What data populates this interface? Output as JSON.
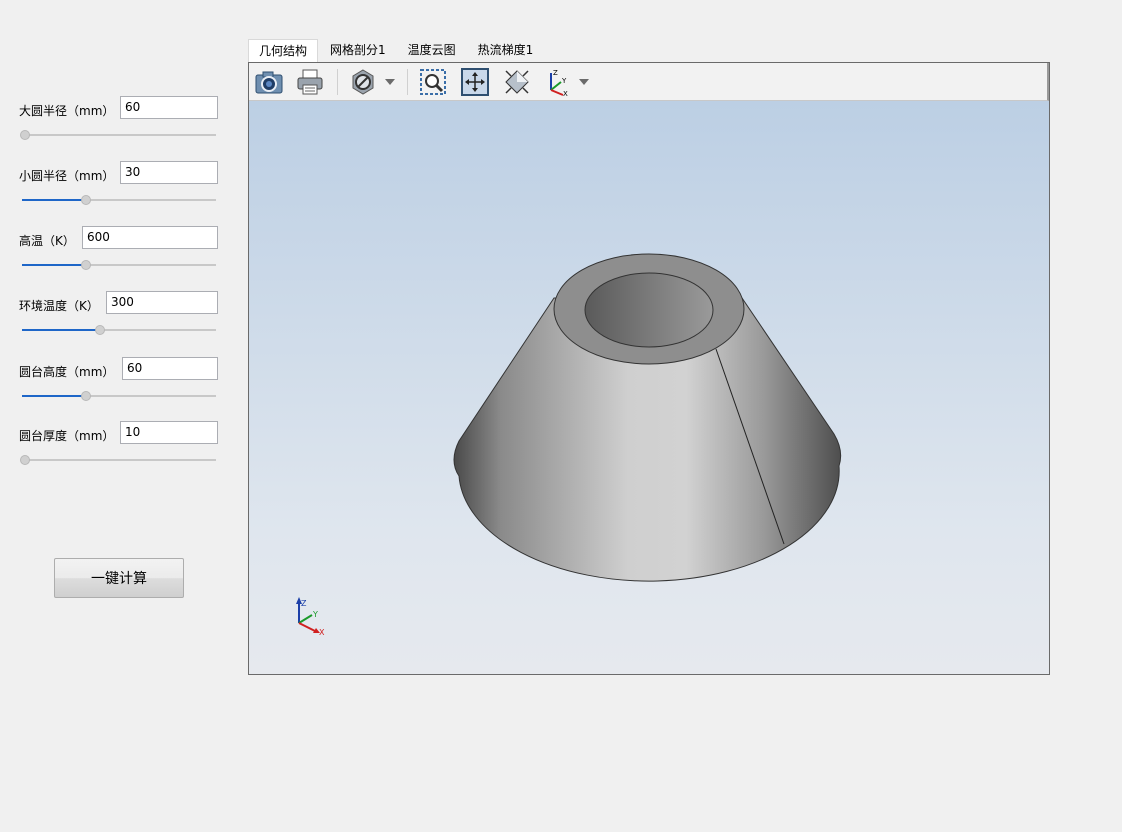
{
  "params": [
    {
      "label": "大圆半径（mm）",
      "value": "60",
      "slider": 0.0
    },
    {
      "label": "小圆半径（mm）",
      "value": "30",
      "slider": 0.33
    },
    {
      "label": "高温（K）",
      "value": "600",
      "slider": 0.33
    },
    {
      "label": "环境温度（K）",
      "value": "300",
      "slider": 0.4
    },
    {
      "label": "圆台高度（mm）",
      "value": "60",
      "slider": 0.33
    },
    {
      "label": "圆台厚度（mm）",
      "value": "10",
      "slider": 0.0
    }
  ],
  "calc_button": "一键计算",
  "tabs": [
    {
      "label": "几何结构",
      "active": true
    },
    {
      "label": "网格剖分1",
      "active": false
    },
    {
      "label": "温度云图",
      "active": false
    },
    {
      "label": "热流梯度1",
      "active": false
    }
  ],
  "toolbar": {
    "icons": [
      "camera-icon",
      "print-icon",
      "display-mode-icon",
      "zoom-window-icon",
      "pan-icon",
      "fit-all-icon",
      "view-axes-icon"
    ]
  },
  "axes": {
    "x": "X",
    "y": "Y",
    "z": "Z"
  },
  "colors": {
    "accent": "#1e66c8",
    "viewer_top": "#bccfe4",
    "viewer_bottom": "#e6e9ee"
  }
}
